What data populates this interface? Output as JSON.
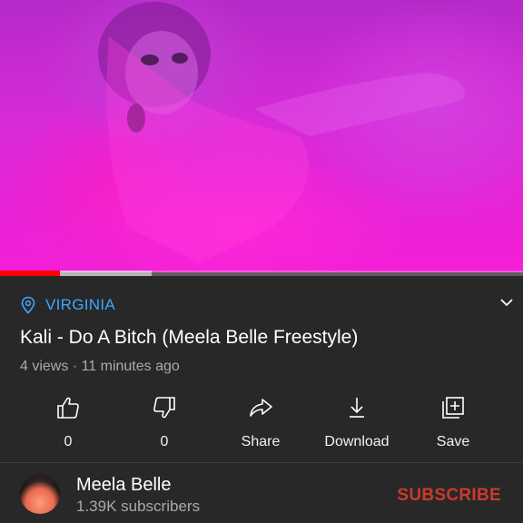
{
  "video": {
    "progress_played_fraction": 0.115,
    "progress_buffered_fraction": 0.29
  },
  "info": {
    "location": "VIRGINIA",
    "title": "Kali - Do A Bitch (Meela Belle Freestyle)",
    "meta": "4 views · 11 minutes ago"
  },
  "actions": [
    {
      "name": "like",
      "icon": "thumbs-up-icon",
      "label": "0"
    },
    {
      "name": "dislike",
      "icon": "thumbs-down-icon",
      "label": "0"
    },
    {
      "name": "share",
      "icon": "share-icon",
      "label": "Share"
    },
    {
      "name": "download",
      "icon": "download-icon",
      "label": "Download"
    },
    {
      "name": "save",
      "icon": "add-to-playlist-icon",
      "label": "Save"
    }
  ],
  "channel": {
    "name": "Meela Belle",
    "subscribers": "1.39K subscribers",
    "subscribe_label": "SUBSCRIBE"
  },
  "colors": {
    "background": "#282828",
    "accent_link": "#3ea6ff",
    "progress": "#ff0000",
    "subscribe": "#cc3a2a"
  }
}
